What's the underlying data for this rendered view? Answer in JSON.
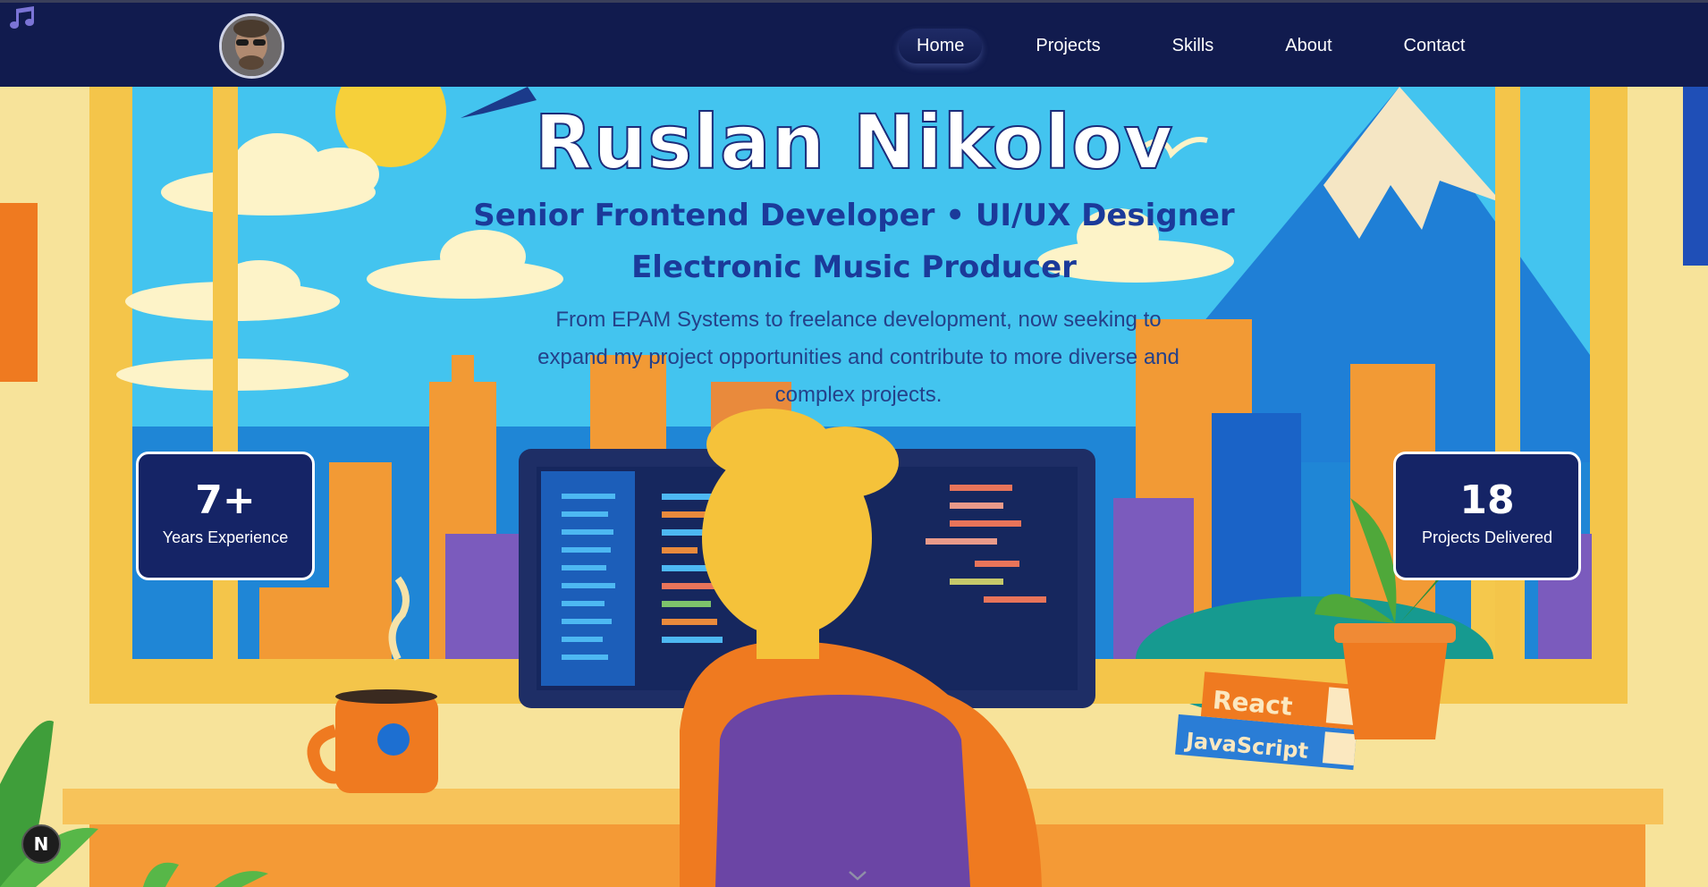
{
  "nav": {
    "items": [
      {
        "label": "Home",
        "active": true
      },
      {
        "label": "Projects"
      },
      {
        "label": "Skills"
      },
      {
        "label": "About"
      },
      {
        "label": "Contact"
      }
    ]
  },
  "hero": {
    "title": "Ruslan Nikolov",
    "subtitle_line1": "Senior Frontend Developer • UI/UX Designer",
    "subtitle_line2": "Electronic Music Producer",
    "description": "From EPAM Systems to freelance development, now seeking to expand my project opportunities and contribute to more diverse and complex projects."
  },
  "stats": [
    {
      "value": "7+",
      "label": "Years Experience"
    },
    {
      "value": "18",
      "label": "Projects Delivered"
    }
  ],
  "illustration": {
    "book_top": "React",
    "book_bottom": "JavaScript"
  },
  "badge": {
    "letter": "N"
  },
  "icons": {
    "music": "music-note-icon",
    "scroll": "chevron-down-icon"
  },
  "colors": {
    "navbar": "#111b4e",
    "card": "#152466",
    "title_outline": "#1c2c7a",
    "subtitle": "#1b3a9a",
    "sky": "#3cc3f0",
    "wall": "#f7e39a"
  }
}
